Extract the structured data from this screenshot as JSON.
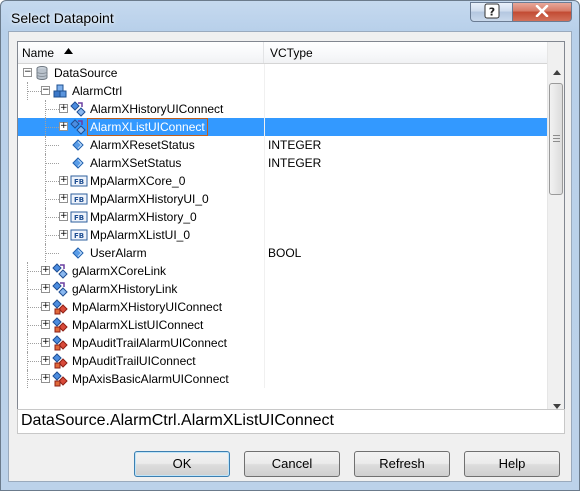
{
  "window": {
    "title": "Select Datapoint"
  },
  "titlebar": {
    "help_icon": "question-icon",
    "close_icon": "close-icon"
  },
  "columns": {
    "name": "Name",
    "vctype": "VCType",
    "sort": "ascending"
  },
  "tree": [
    {
      "label": "DataSource",
      "vctype": "",
      "icon": "database-icon",
      "toggle": "−"
    },
    {
      "label": "AlarmCtrl",
      "vctype": "",
      "icon": "package-icon",
      "toggle": "−"
    },
    {
      "label": "AlarmXHistoryUIConnect",
      "vctype": "",
      "icon": "struct-icon",
      "toggle": "+"
    },
    {
      "label": "AlarmXListUIConnect",
      "vctype": "",
      "icon": "struct-icon",
      "toggle": "+",
      "selected": true
    },
    {
      "label": "AlarmXResetStatus",
      "vctype": "INTEGER",
      "icon": "variable-icon",
      "toggle": ""
    },
    {
      "label": "AlarmXSetStatus",
      "vctype": "INTEGER",
      "icon": "variable-icon",
      "toggle": ""
    },
    {
      "label": "MpAlarmXCore_0",
      "vctype": "",
      "icon": "function-block-icon",
      "toggle": "+"
    },
    {
      "label": "MpAlarmXHistoryUI_0",
      "vctype": "",
      "icon": "function-block-icon",
      "toggle": "+"
    },
    {
      "label": "MpAlarmXHistory_0",
      "vctype": "",
      "icon": "function-block-icon",
      "toggle": "+"
    },
    {
      "label": "MpAlarmXListUI_0",
      "vctype": "",
      "icon": "function-block-icon",
      "toggle": "+"
    },
    {
      "label": "UserAlarm",
      "vctype": "BOOL",
      "icon": "variable-icon",
      "toggle": ""
    },
    {
      "label": "gAlarmXCoreLink",
      "vctype": "",
      "icon": "struct-icon",
      "toggle": "+"
    },
    {
      "label": "gAlarmXHistoryLink",
      "vctype": "",
      "icon": "struct-icon",
      "toggle": "+"
    },
    {
      "label": "MpAlarmXHistoryUIConnect",
      "vctype": "",
      "icon": "type-icon",
      "toggle": "+"
    },
    {
      "label": "MpAlarmXListUIConnect",
      "vctype": "",
      "icon": "type-icon",
      "toggle": "+"
    },
    {
      "label": "MpAuditTrailAlarmUIConnect",
      "vctype": "",
      "icon": "type-icon",
      "toggle": "+"
    },
    {
      "label": "MpAuditTrailUIConnect",
      "vctype": "",
      "icon": "type-icon",
      "toggle": "+"
    },
    {
      "label": "MpAxisBasicAlarmUIConnect",
      "vctype": "",
      "icon": "type-icon",
      "toggle": "+"
    }
  ],
  "path": {
    "value": "DataSource.AlarmCtrl.AlarmXListUIConnect"
  },
  "buttons": {
    "ok": "OK",
    "cancel": "Cancel",
    "refresh": "Refresh",
    "help": "Help"
  },
  "fb_badge": "FB"
}
